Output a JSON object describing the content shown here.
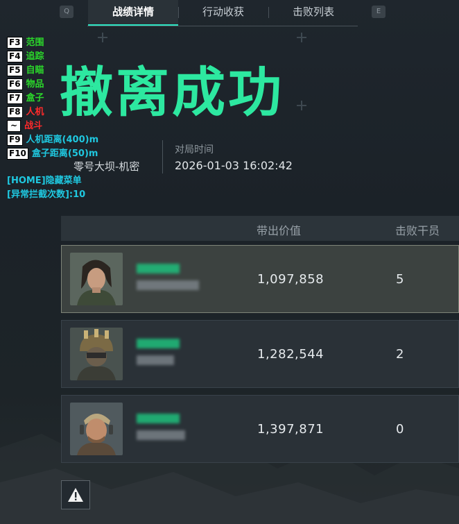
{
  "tabs": {
    "left_key": "Q",
    "right_key": "E",
    "items": [
      "战绩详情",
      "行动收获",
      "击败列表"
    ]
  },
  "overlay": {
    "items": [
      {
        "key": "F3",
        "label": "范围",
        "color": "#2bd62b"
      },
      {
        "key": "F4",
        "label": "追踪",
        "color": "#2bd62b"
      },
      {
        "key": "F5",
        "label": "自瞄",
        "color": "#2bd62b"
      },
      {
        "key": "F6",
        "label": "物品",
        "color": "#2bd62b"
      },
      {
        "key": "F7",
        "label": "盒子",
        "color": "#2bd62b"
      },
      {
        "key": "F8",
        "label": "人机",
        "color": "#ff2a2a"
      },
      {
        "key": "~",
        "label": "战斗",
        "color": "#ff2a2a"
      },
      {
        "key": "F9",
        "label": "人机距离(400)m",
        "color": "#1fc8e0"
      },
      {
        "key": "F10",
        "label": "盒子距离(50)m",
        "color": "#1fc8e0"
      }
    ],
    "menu_hint": "[HOME]隐藏菜单",
    "intercept": "[异常拦截次数]:10"
  },
  "result": {
    "title": "撤离成功",
    "map": "零号大坝-机密",
    "time_label": "对局时间",
    "time_value": "2026-01-03 16:02:42"
  },
  "table": {
    "headers": {
      "value": "带出价值",
      "kills": "击败干员"
    },
    "rows": [
      {
        "value": "1,097,858",
        "kills": "5",
        "avatar": "female-operator"
      },
      {
        "value": "1,282,544",
        "kills": "2",
        "avatar": "masked-operator"
      },
      {
        "value": "1,397,871",
        "kills": "0",
        "avatar": "male-operator"
      }
    ]
  },
  "colors": {
    "accent": "#2de8a0",
    "tab_underline": "#2ee6c4"
  },
  "icons": {
    "warning": "warning-triangle-icon"
  }
}
